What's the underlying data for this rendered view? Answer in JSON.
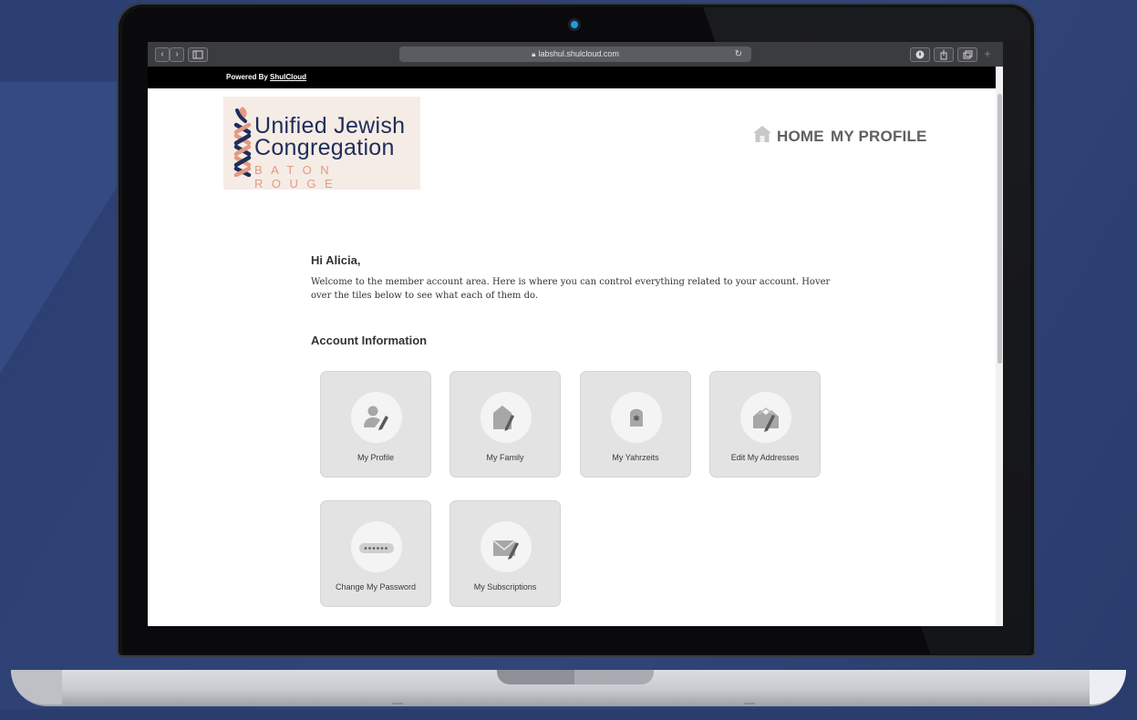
{
  "browser": {
    "url": "labshul.shulcloud.com",
    "nav_back": "‹",
    "nav_forward": "›"
  },
  "powered_by": {
    "prefix": "Powered By",
    "link": "ShulCloud"
  },
  "logo": {
    "line1": "Unified Jewish",
    "line2": "Congregation",
    "line3": "BATON ROUGE"
  },
  "nav": {
    "home": "HOME",
    "my_profile": "MY PROFILE"
  },
  "greeting": "Hi Alicia,",
  "welcome_text": "Welcome to the member account area. Here is where you can control everything related to your account. Hover over the tiles below to see what each of them do.",
  "section_title": "Account Information",
  "tiles": [
    {
      "label": "My Profile",
      "icon": "person-edit-icon"
    },
    {
      "label": "My Family",
      "icon": "house-edit-icon"
    },
    {
      "label": "My Yahrzeits",
      "icon": "tombstone-icon"
    },
    {
      "label": "Edit My Addresses",
      "icon": "houses-edit-icon"
    },
    {
      "label": "Change My Password",
      "icon": "password-dots-icon"
    },
    {
      "label": "My Subscriptions",
      "icon": "envelope-edit-icon"
    }
  ],
  "colors": {
    "brand_navy": "#1f2d5c",
    "brand_peach": "#e39a82",
    "tile_bg": "#e3e3e3"
  }
}
